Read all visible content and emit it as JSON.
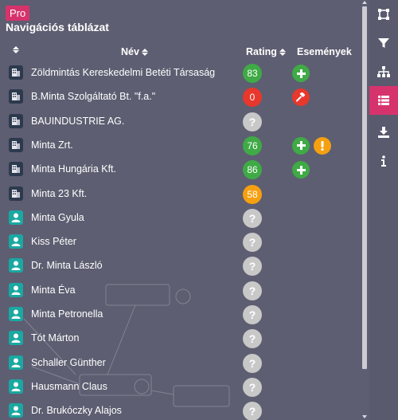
{
  "header": {
    "badge": "Pro",
    "title": "Navigációs táblázat",
    "columns": {
      "name": "Név",
      "rating": "Rating",
      "events": "Események"
    }
  },
  "colors": {
    "accent": "#d6336c",
    "rating_green": "#3faa46",
    "rating_red": "#e8372c",
    "rating_orange": "#f5a011",
    "rating_unknown": "#c8c8c8",
    "company_icon": "#2d3a4e",
    "person_icon": "#1aa8a2"
  },
  "rows": [
    {
      "type": "company",
      "name": "Zöldmintás Kereskedelmi Betéti Társaság",
      "rating": "83",
      "rating_color": "green",
      "events": [
        "plus"
      ]
    },
    {
      "type": "company",
      "name": "B.Minta Szolgáltató Bt. \"f.a.\"",
      "rating": "0",
      "rating_color": "red",
      "events": [
        "gavel"
      ]
    },
    {
      "type": "company",
      "name": "BAUINDUSTRIE AG.",
      "rating": "?",
      "rating_color": "unknown",
      "events": []
    },
    {
      "type": "company",
      "name": "Minta Zrt.",
      "rating": "76",
      "rating_color": "green",
      "events": [
        "plus",
        "warning"
      ]
    },
    {
      "type": "company",
      "name": "Minta Hungária Kft.",
      "rating": "86",
      "rating_color": "green",
      "events": [
        "plus"
      ]
    },
    {
      "type": "company",
      "name": "Minta 23 Kft.",
      "rating": "58",
      "rating_color": "orange",
      "events": []
    },
    {
      "type": "person",
      "name": "Minta Gyula",
      "rating": "?",
      "rating_color": "unknown",
      "events": []
    },
    {
      "type": "person",
      "name": "Kiss Péter",
      "rating": "?",
      "rating_color": "unknown",
      "events": []
    },
    {
      "type": "person",
      "name": "Dr. Minta László",
      "rating": "?",
      "rating_color": "unknown",
      "events": []
    },
    {
      "type": "person",
      "name": "Minta Éva",
      "rating": "?",
      "rating_color": "unknown",
      "events": []
    },
    {
      "type": "person",
      "name": "Minta Petronella",
      "rating": "?",
      "rating_color": "unknown",
      "events": []
    },
    {
      "type": "person",
      "name": "Tót Márton",
      "rating": "?",
      "rating_color": "unknown",
      "events": []
    },
    {
      "type": "person",
      "name": "Schaller Günther",
      "rating": "?",
      "rating_color": "unknown",
      "events": []
    },
    {
      "type": "person",
      "name": "Hausmann Claus",
      "rating": "?",
      "rating_color": "unknown",
      "events": []
    },
    {
      "type": "person",
      "name": "Dr. Brukóczky Alajos",
      "rating": "?",
      "rating_color": "unknown",
      "events": []
    }
  ],
  "toolbar": [
    {
      "icon": "frame-icon",
      "active": false
    },
    {
      "icon": "filter-icon",
      "active": false
    },
    {
      "icon": "hierarchy-icon",
      "active": false
    },
    {
      "icon": "list-icon",
      "active": true
    },
    {
      "icon": "download-icon",
      "active": false
    },
    {
      "icon": "info-icon",
      "active": false
    }
  ]
}
